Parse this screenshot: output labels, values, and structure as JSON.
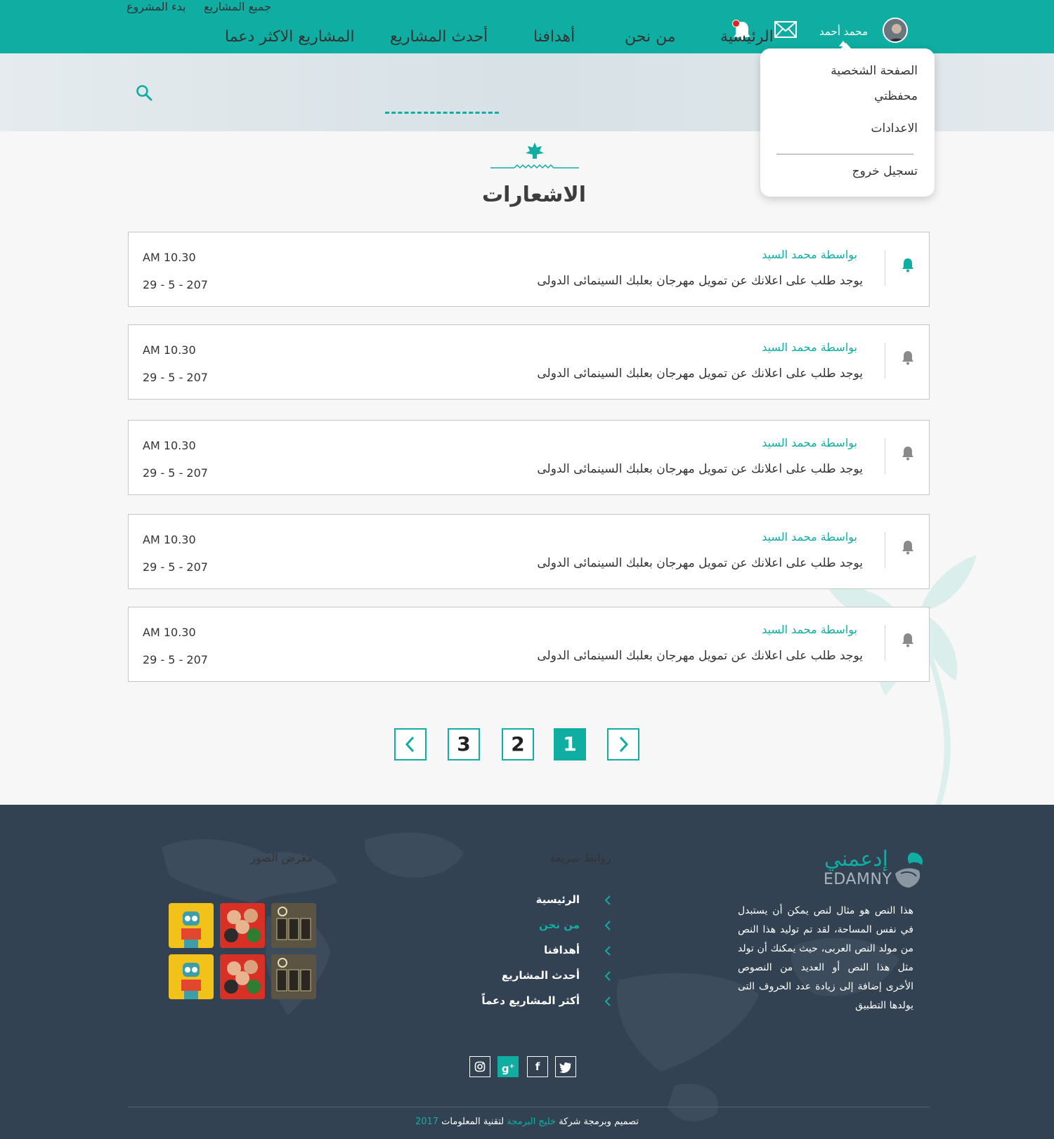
{
  "topbar": {
    "user_name": "محمد أحمد",
    "all_projects": "جميع المشاريع",
    "start_project": "بدء المشروع"
  },
  "dropdown": {
    "items": [
      "الصفحة الشخصية",
      "محفظتي",
      "الاعدادات",
      "تسجيل خروج"
    ]
  },
  "nav": {
    "items": [
      "الرئيسية",
      "من نحن",
      "أهدافنا",
      "أحدث المشاريع",
      "المشاريع الاكثر دعما"
    ],
    "active": "أحدث المشاريع"
  },
  "page_title": "الاشعارات",
  "notifications": [
    {
      "author": "بواسطة محمد السيد",
      "message": "يوجد طلب على اعلانك عن تمويل مهرجان بعلبك السينمائى الدولى",
      "time": "AM 10.30",
      "date": "29 - 5 - 207",
      "unread": true
    },
    {
      "author": "بواسطة محمد السيد",
      "message": "يوجد طلب على اعلانك عن تمويل مهرجان بعلبك السينمائى الدولى",
      "time": "AM 10.30",
      "date": "29 - 5 - 207",
      "unread": false
    },
    {
      "author": "بواسطة محمد السيد",
      "message": "يوجد طلب على اعلانك عن تمويل مهرجان بعلبك السينمائى الدولى",
      "time": "AM 10.30",
      "date": "29 - 5 - 207",
      "unread": false
    },
    {
      "author": "بواسطة محمد السيد",
      "message": "يوجد طلب على اعلانك عن تمويل مهرجان بعلبك السينمائى الدولى",
      "time": "AM 10.30",
      "date": "29 - 5 - 207",
      "unread": false
    },
    {
      "author": "بواسطة محمد السيد",
      "message": "يوجد طلب على اعلانك عن تمويل مهرجان بعلبك السينمائى الدولى",
      "time": "AM 10.30",
      "date": "29 - 5 - 207",
      "unread": false
    }
  ],
  "pagination": {
    "pages": [
      "3",
      "2",
      "1"
    ],
    "current": "1"
  },
  "footer": {
    "logo_ar": "إدعمني",
    "logo_en": "EDAMNY",
    "about": "هذا النص هو مثال لنص يمكن أن يستبدل في نفس المساحة، لقد تم توليد هذا النص من مولد النص العربى، حيث يمكنك أن تولد مثل هذا النص أو العديد من النصوص الأخرى إضافة إلى زيادة عدد الحروف التى يولدها التطبيق",
    "quick_links_title": "روابط سريعة",
    "quick_links": [
      "الرئيسية",
      "من نحن",
      "أهدافنا",
      "أحدث المشاريع",
      "أكثر المشاريع دعماً"
    ],
    "quick_links_active": "من نحن",
    "gallery_title": "معرض الصور",
    "copyright_pre": "تصميم وبرمجة شركة",
    "copyright_company": "خليج البرمجة",
    "copyright_post": "لتقنية المعلومات",
    "copyright_year": "2017"
  },
  "colors": {
    "accent": "#0fada2",
    "footer_bg": "#334252",
    "unread_dot": "#e5211c"
  }
}
